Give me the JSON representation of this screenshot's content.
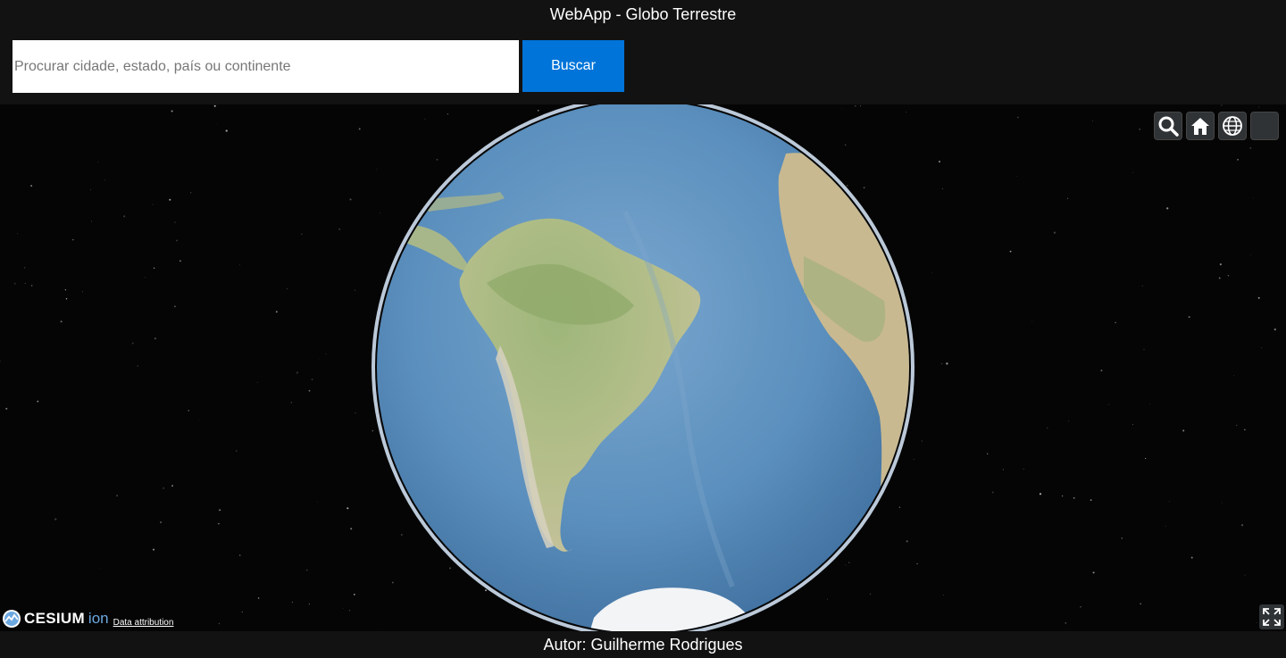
{
  "header": {
    "title": "WebApp - Globo Terrestre",
    "search": {
      "placeholder": "Procurar cidade, estado, país ou continente",
      "value": ""
    },
    "search_button_label": "Buscar"
  },
  "viewer": {
    "toolbar": [
      {
        "name": "geocoder-search-button",
        "icon": "search-icon"
      },
      {
        "name": "home-button",
        "icon": "home-icon"
      },
      {
        "name": "scene-mode-button",
        "icon": "globe-icon"
      },
      {
        "name": "base-layer-picker-button",
        "icon": "layers-icon"
      }
    ],
    "credits": {
      "logo_text": "CESIUM",
      "logo_suffix": "ion",
      "attribution_label": "Data attribution"
    },
    "fullscreen_icon": "fullscreen-icon"
  },
  "colors": {
    "background": "#121212",
    "button_accent": "#0074d9",
    "ocean": "#5f93bf",
    "land": "#9fb47d"
  },
  "footer": {
    "author": "Autor: Guilherme Rodrigues"
  }
}
